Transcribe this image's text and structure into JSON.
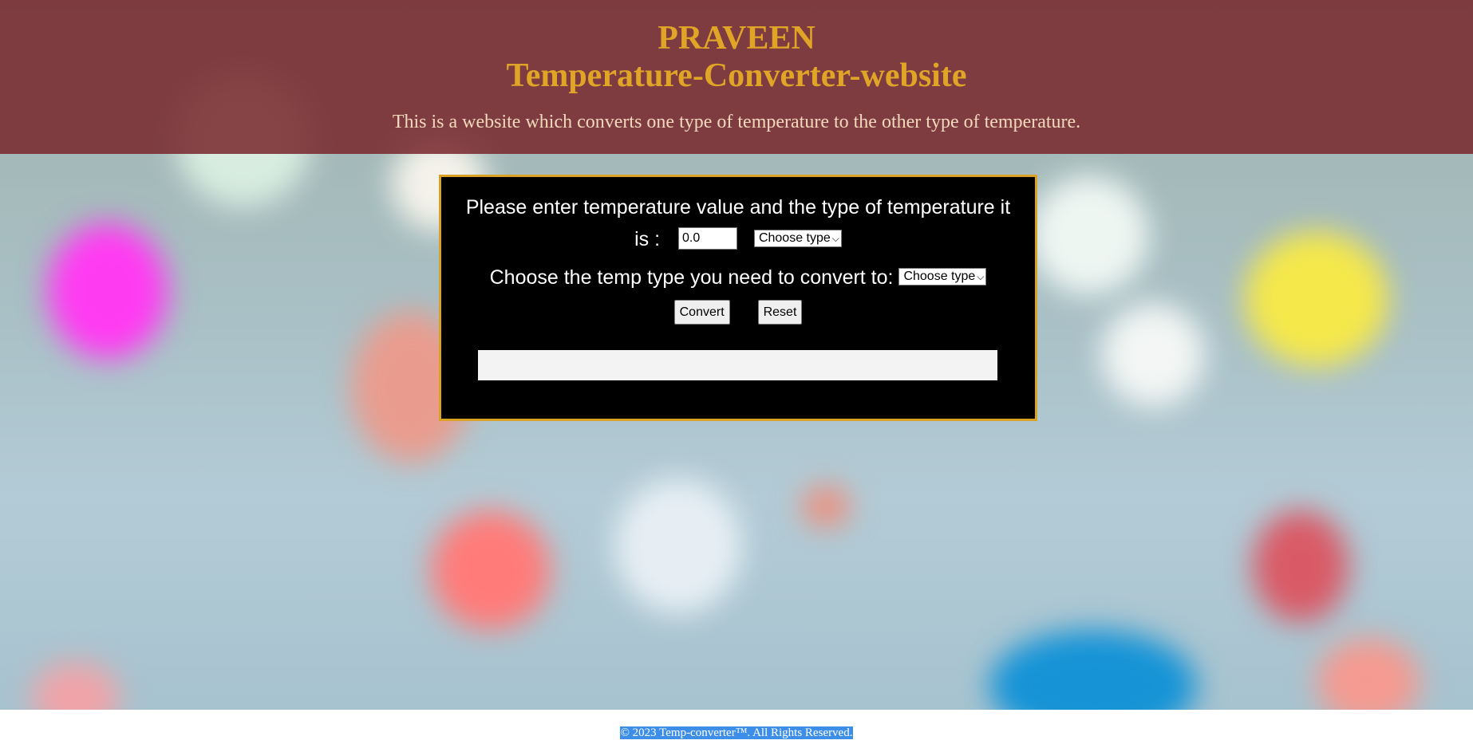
{
  "header": {
    "author": "PRAVEEN",
    "title": "Temperature-Converter-website",
    "tagline": "This is a website which converts one type of temperature to the other type of temperature."
  },
  "converter": {
    "prompt_line1": "Please enter temperature value and the type of temperature it",
    "prompt_line2": "is :",
    "input_value": "0.0",
    "from_select": "Choose type",
    "to_prompt": "Choose the temp type you need to convert to:",
    "to_select": "Choose type",
    "convert_label": "Convert",
    "reset_label": "Reset",
    "result": ""
  },
  "footer": {
    "copyright": "© 2023 Temp-converter™. All Rights Reserved."
  },
  "colors": {
    "header_bg": "#78282d",
    "header_text": "#e0a426",
    "panel_border": "#d9a224",
    "panel_bg": "#000000",
    "selection_highlight": "#3c8ee8"
  }
}
